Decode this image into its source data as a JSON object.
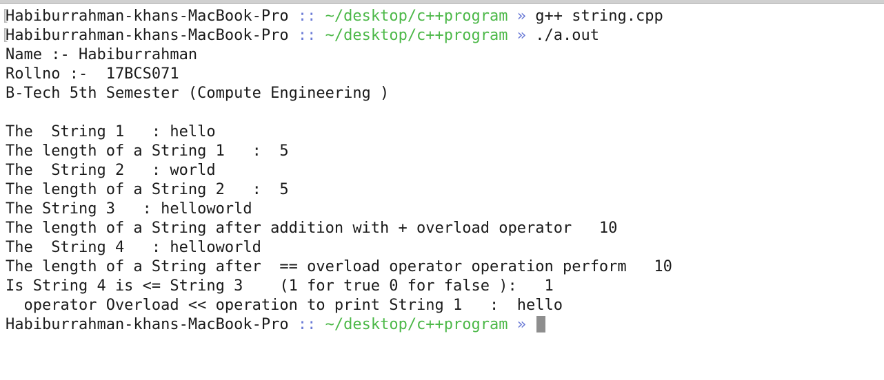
{
  "prompt": {
    "host": "Habiburrahman-khans-MacBook-Pro",
    "separator": "::",
    "path": "~/desktop/c++program",
    "arrow": "»"
  },
  "lines": [
    {
      "kind": "prompt",
      "bracket": "[",
      "command": "g++ string.cpp"
    },
    {
      "kind": "prompt",
      "bracket": "[",
      "command": "./a.out"
    },
    {
      "kind": "output",
      "text": "Name :- Habiburrahman"
    },
    {
      "kind": "output",
      "text": "Rollno :-  17BCS071"
    },
    {
      "kind": "output",
      "text": "B-Tech 5th Semester (Compute Engineering )"
    },
    {
      "kind": "output",
      "text": ""
    },
    {
      "kind": "output",
      "text": "The  String 1   : hello"
    },
    {
      "kind": "output",
      "text": "The length of a String 1   :  5"
    },
    {
      "kind": "output",
      "text": "The  String 2   : world"
    },
    {
      "kind": "output",
      "text": "The length of a String 2   :  5"
    },
    {
      "kind": "output",
      "text": "The String 3   : helloworld"
    },
    {
      "kind": "output",
      "text": "The length of a String after addition with + overload operator   10"
    },
    {
      "kind": "output",
      "text": "The  String 4   : helloworld"
    },
    {
      "kind": "output",
      "text": "The length of a String after  == overload operator operation perform   10"
    },
    {
      "kind": "output",
      "text": "Is String 4 is <= String 3    (1 for true 0 for false ):   1"
    },
    {
      "kind": "output",
      "text": "  operator Overload << operation to print String 1   :  hello"
    },
    {
      "kind": "prompt",
      "bracket": "",
      "command": "",
      "cursor": true
    }
  ]
}
